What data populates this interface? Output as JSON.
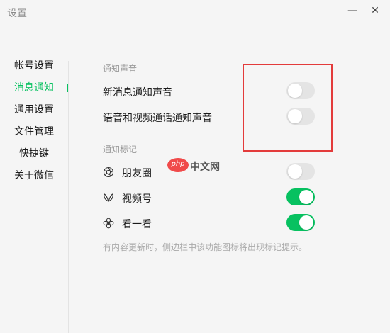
{
  "window": {
    "title": "设置",
    "minimize_glyph": "—",
    "close_glyph": "✕"
  },
  "sidebar": {
    "items": [
      {
        "label": "帐号设置",
        "active": false
      },
      {
        "label": "消息通知",
        "active": true
      },
      {
        "label": "通用设置",
        "active": false
      },
      {
        "label": "文件管理",
        "active": false
      },
      {
        "label": "快捷键",
        "active": false
      },
      {
        "label": "关于微信",
        "active": false
      }
    ]
  },
  "notification_sound": {
    "section_title": "通知声音",
    "new_message": {
      "label": "新消息通知声音",
      "enabled": false
    },
    "voice_video": {
      "label": "语音和视频通话通知声音",
      "enabled": false
    }
  },
  "notification_badge": {
    "section_title": "通知标记",
    "moments": {
      "label": "朋友圈",
      "icon": "moments-shutter-icon",
      "enabled": false
    },
    "channels": {
      "label": "视频号",
      "icon": "channels-butterfly-icon",
      "enabled": true
    },
    "top_stories": {
      "label": "看一看",
      "icon": "top-stories-flower-icon",
      "enabled": true
    },
    "hint": "有内容更新时，侧边栏中该功能图标将出现标记提示。"
  },
  "watermark": {
    "badge": "php",
    "text": "中文网"
  },
  "colors": {
    "accent": "#07c160",
    "highlight_border": "#e33b3b",
    "toggle_off": "#e4e4e4"
  }
}
